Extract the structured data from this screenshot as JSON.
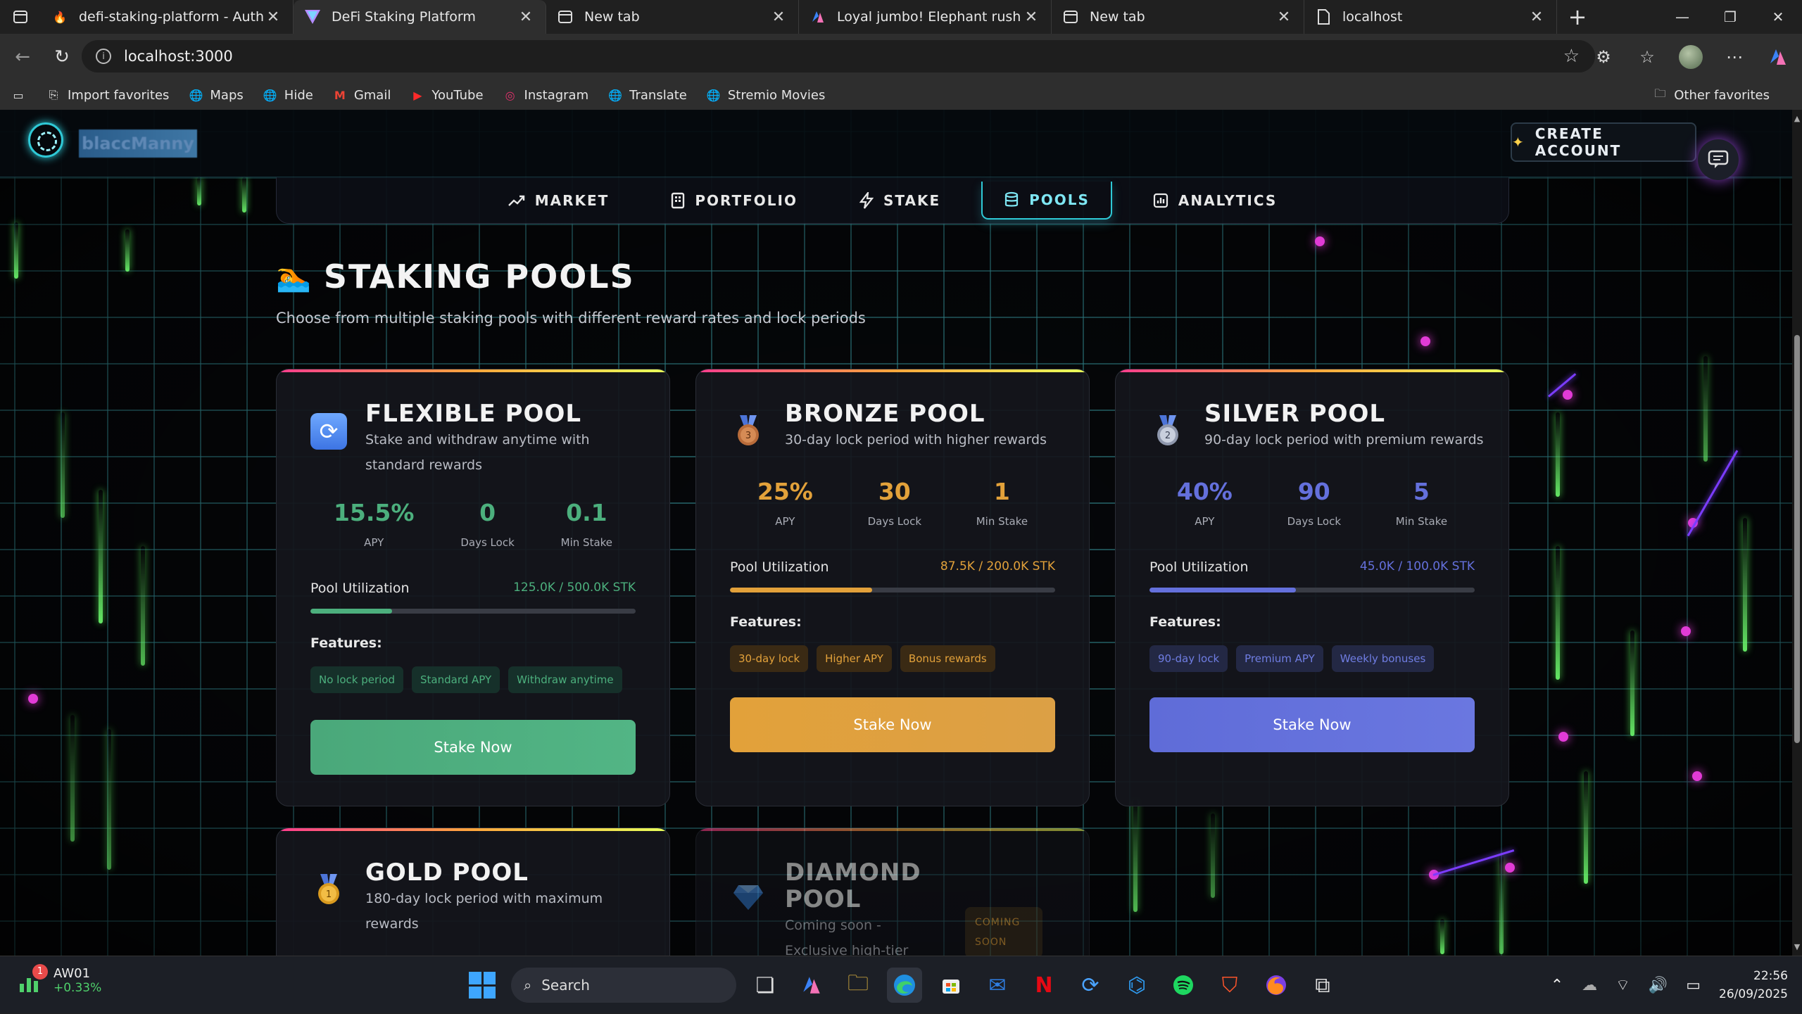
{
  "browser": {
    "tabs": [
      {
        "title": "defi-staking-platform - Authentic",
        "favicon": "fire-icon",
        "active": false
      },
      {
        "title": "DeFi Staking Platform",
        "favicon": "v-logo-icon",
        "active": true
      },
      {
        "title": "New tab",
        "favicon": "newtab-icon",
        "active": false
      },
      {
        "title": "Loyal jumbo! Elephant rushes to s",
        "favicon": "copilot-icon",
        "active": false
      },
      {
        "title": "New tab",
        "favicon": "newtab-icon",
        "active": false
      },
      {
        "title": "localhost",
        "favicon": "page-icon",
        "active": false
      }
    ],
    "url": "localhost:3000",
    "bookmarks": [
      {
        "label": "Import favorites"
      },
      {
        "label": "Maps"
      },
      {
        "label": "Hide"
      },
      {
        "label": "Gmail"
      },
      {
        "label": "YouTube"
      },
      {
        "label": "Instagram"
      },
      {
        "label": "Translate"
      },
      {
        "label": "Stremio Movies"
      }
    ],
    "other_favorites": "Other favorites"
  },
  "app": {
    "logo_text": "blaccManny",
    "create_account": "CREATE ACCOUNT",
    "nav": [
      {
        "label": "MARKET",
        "icon": "trend-up-icon",
        "active": false
      },
      {
        "label": "PORTFOLIO",
        "icon": "building-icon",
        "active": false
      },
      {
        "label": "STAKE",
        "icon": "lightning-icon",
        "active": false
      },
      {
        "label": "POOLS",
        "icon": "cylinder-icon",
        "active": true
      },
      {
        "label": "ANALYTICS",
        "icon": "bar-chart-icon",
        "active": false
      }
    ],
    "section_title": "STAKING POOLS",
    "section_subtitle": "Choose from multiple staking pools with different reward rates and lock periods",
    "labels": {
      "apy": "APY",
      "days_lock": "Days Lock",
      "min_stake": "Min Stake",
      "pool_utilization": "Pool Utilization",
      "features": "Features:",
      "stake_now": "Stake Now"
    },
    "pools": [
      {
        "name": "FLEXIBLE POOL",
        "desc": "Stake and withdraw anytime with standard rewards",
        "icon": "refresh-icon",
        "apy": "15.5%",
        "days_lock": "0",
        "min_stake": "0.1",
        "utilization_text": "125.0K / 500.0K STK",
        "utilization": 0.25,
        "features": [
          "No lock period",
          "Standard APY",
          "Withdraw anytime"
        ],
        "accent": "#4caf7d"
      },
      {
        "name": "BRONZE POOL",
        "desc": "30-day lock period with higher rewards",
        "icon": "bronze-medal-icon",
        "apy": "25%",
        "days_lock": "30",
        "min_stake": "1",
        "utilization_text": "87.5K / 200.0K STK",
        "utilization": 0.4375,
        "features": [
          "30-day lock",
          "Higher APY",
          "Bonus rewards"
        ],
        "accent": "#e2a13a"
      },
      {
        "name": "SILVER POOL",
        "desc": "90-day lock period with premium rewards",
        "icon": "silver-medal-icon",
        "apy": "40%",
        "days_lock": "90",
        "min_stake": "5",
        "utilization_text": "45.0K / 100.0K STK",
        "utilization": 0.45,
        "features": [
          "90-day lock",
          "Premium APY",
          "Weekly bonuses"
        ],
        "accent": "#6470dc"
      }
    ],
    "pools_lower": [
      {
        "name": "GOLD POOL",
        "desc": "180-day lock period with maximum rewards",
        "icon": "gold-medal-icon"
      },
      {
        "name": "DIAMOND POOL",
        "desc": "Coming soon - Exclusive high-tier staking",
        "icon": "diamond-icon",
        "badge": "COMING SOON"
      }
    ]
  },
  "taskbar": {
    "stock_name": "AW01",
    "stock_change": "+0.33%",
    "stock_badge": "1",
    "search": "Search",
    "time": "22:56",
    "date": "26/09/2025"
  }
}
